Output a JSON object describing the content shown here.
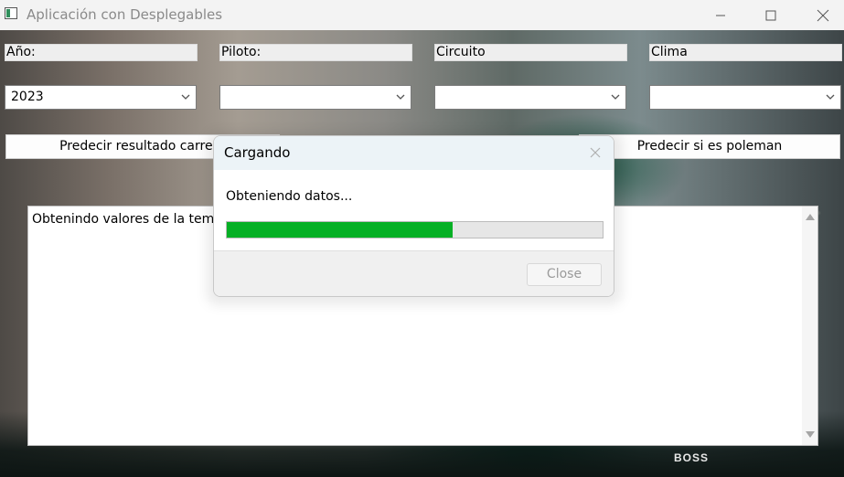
{
  "window": {
    "title": "Aplicación con Desplegables"
  },
  "labels": {
    "year": "Año:",
    "driver": "Piloto:",
    "circuit": "Circuito",
    "weather": "Clima"
  },
  "combos": {
    "year_value": "2023",
    "driver_value": "",
    "circuit_value": "",
    "weather_value": ""
  },
  "buttons": {
    "predict_race": "Predecir resultado carrera",
    "predict_pole": "Predecir si es poleman"
  },
  "output": {
    "text": "Obtenindo valores de la temporada..."
  },
  "background": {
    "sponsor_text": "BOSS"
  },
  "dialog": {
    "title": "Cargando",
    "message": "Obteniendo datos...",
    "progress_percent": 60,
    "close_label": "Close",
    "progress_color": "#06b025"
  }
}
